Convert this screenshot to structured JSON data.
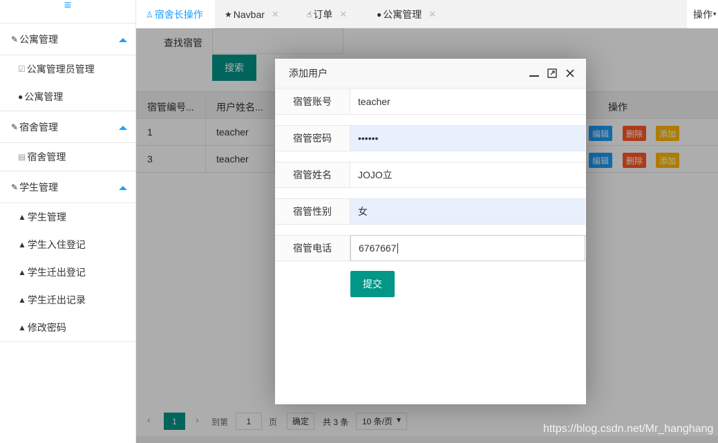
{
  "sidebar": {
    "toggle_icon": "menu-icon",
    "groups": [
      {
        "label": "公寓管理",
        "items": [
          "公寓管理员管理",
          "公寓管理"
        ]
      },
      {
        "label": "宿舍管理",
        "items": [
          "宿舍管理"
        ]
      },
      {
        "label": "学生管理",
        "items": [
          "学生管理",
          "学生入住登记",
          "学生迁出登记",
          "学生迁出记录",
          "修改密码"
        ]
      }
    ]
  },
  "tabs": [
    {
      "label": "宿舍长操作",
      "active": true
    },
    {
      "label": "Navbar"
    },
    {
      "label": "订单"
    },
    {
      "label": "公寓管理"
    }
  ],
  "tabs_ops": "操作",
  "search": {
    "label": "查找宿管",
    "button": "搜索"
  },
  "table": {
    "headers": [
      "宿管编号...",
      "用户姓名...",
      "操作"
    ],
    "rows": [
      {
        "id": "1",
        "name": "teacher"
      },
      {
        "id": "3",
        "name": "teacher"
      }
    ],
    "actions": [
      "编辑",
      "删除",
      "添加"
    ]
  },
  "pager": {
    "current": "1",
    "goto_label": "到第",
    "goto_value": "1",
    "page_unit": "页",
    "confirm": "确定",
    "total": "共 3 条",
    "page_size": "10 条/页"
  },
  "modal": {
    "title": "添加用户",
    "fields": [
      {
        "label": "宿管账号",
        "value": "teacher"
      },
      {
        "label": "宿管密码",
        "value": "••••••"
      },
      {
        "label": "宿管姓名",
        "value": "JOJO立"
      },
      {
        "label": "宿管性别",
        "value": "女"
      },
      {
        "label": "宿管电话",
        "value": "6767667"
      }
    ],
    "submit": "提交"
  },
  "watermark": "https://blog.csdn.net/Mr_hanghang",
  "colors": {
    "primary": "#009688",
    "accent": "#1e9fff",
    "danger": "#ff5722",
    "warn": "#ffb800",
    "autofill": "#e8f0fe"
  }
}
